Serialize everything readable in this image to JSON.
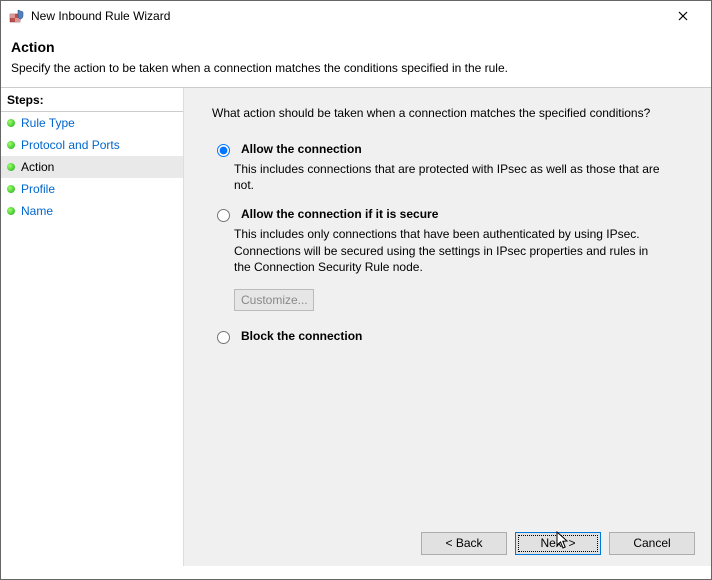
{
  "window": {
    "title": "New Inbound Rule Wizard"
  },
  "header": {
    "title": "Action",
    "description": "Specify the action to be taken when a connection matches the conditions specified in the rule."
  },
  "sidebar": {
    "title": "Steps:",
    "items": [
      {
        "label": "Rule Type",
        "current": false
      },
      {
        "label": "Protocol and Ports",
        "current": false
      },
      {
        "label": "Action",
        "current": true
      },
      {
        "label": "Profile",
        "current": false
      },
      {
        "label": "Name",
        "current": false
      }
    ]
  },
  "main": {
    "question": "What action should be taken when a connection matches the specified conditions?",
    "options": [
      {
        "id": "allow",
        "title": "Allow the connection",
        "desc": "This includes connections that are protected with IPsec as well as those that are not.",
        "selected": true,
        "hasCustomize": false
      },
      {
        "id": "allow-secure",
        "title": "Allow the connection if it is secure",
        "desc": "This includes only connections that have been authenticated by using IPsec.  Connections will be secured using the settings in IPsec properties and rules in the Connection Security Rule node.",
        "selected": false,
        "hasCustomize": true
      },
      {
        "id": "block",
        "title": "Block the connection",
        "desc": "",
        "selected": false,
        "hasCustomize": false
      }
    ],
    "customize_label": "Customize..."
  },
  "footer": {
    "back": "< Back",
    "next": "Next >",
    "cancel": "Cancel"
  }
}
